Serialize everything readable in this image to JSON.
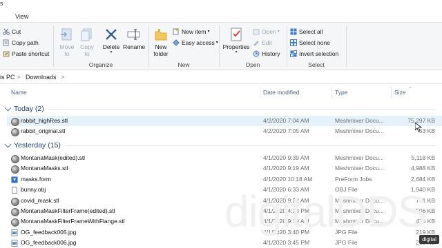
{
  "window": {
    "title_fragment": "s"
  },
  "ribbon_tabs": {
    "view": "View"
  },
  "ribbon": {
    "clipboard": {
      "cut": "Cut",
      "copy_path": "Copy path",
      "paste_shortcut": "Paste shortcut"
    },
    "organize": {
      "label": "Organize",
      "move_to": "Move\nto",
      "copy_to": "Copy\nto",
      "delete": "Delete",
      "rename": "Rename"
    },
    "new": {
      "label": "New",
      "new_folder": "New\nfolder",
      "new_item": "New item",
      "easy_access": "Easy access"
    },
    "open": {
      "label": "Open",
      "properties": "Properties",
      "open": "Open",
      "edit": "Edit",
      "history": "History"
    },
    "select": {
      "label": "Select",
      "select_all": "Select all",
      "select_none": "Select none",
      "invert": "Invert selection"
    }
  },
  "address": {
    "this_pc": "is PC",
    "sep1": ">",
    "downloads": "Downloads",
    "sep2": ">"
  },
  "columns": {
    "name": "Name",
    "date": "Date modified",
    "type": "Type",
    "size": "Size"
  },
  "groups": [
    {
      "label": "Today (2)"
    },
    {
      "label": "Yesterday (15)"
    }
  ],
  "today_rows": [
    {
      "name": "rabbit_highRes.stl",
      "date": "4/2/2020 7:04 AM",
      "type": "Meshmixer Docu...",
      "size": "75,297 KB",
      "icon": "mesh-icon",
      "selected": true
    },
    {
      "name": "rabbit_original.stl",
      "date": "4/2/2020 7:05 AM",
      "type": "Meshmixer Docu...",
      "size": "53 KB",
      "icon": "mesh-icon",
      "selected": false
    }
  ],
  "yesterday_rows": [
    {
      "name": "MontanaMask(edited).stl",
      "date": "4/1/2020 9:39 AM",
      "type": "Meshmixer Docu...",
      "size": "5,118 KB",
      "icon": "mesh-icon"
    },
    {
      "name": "MontanaMasks.stl",
      "date": "4/1/2020 9:19 AM",
      "type": "Meshmixer Docu...",
      "size": "4,988 KB",
      "icon": "mesh-icon"
    },
    {
      "name": "masks.form",
      "date": "4/1/2020 10:18 AM",
      "type": "PreForm Jobs",
      "size": "2,684 KB",
      "icon": "form-icon"
    },
    {
      "name": "bunny.obj",
      "date": "4/1/2020 6:33 AM",
      "type": "OBJ File",
      "size": "1,940 KB",
      "icon": "file-icon"
    },
    {
      "name": "covid_mask.stl",
      "date": "4/1/2020 9:22 AM",
      "type": "Meshmixer Docu...",
      "size": "741 KB",
      "icon": "mesh-icon"
    },
    {
      "name": "MontanaMaskFilterFrame(edited).stl",
      "date": "4/1/2020 4:28 PM",
      "type": "Meshmixer Docu...",
      "size": "506 KB",
      "icon": "mesh-icon"
    },
    {
      "name": "MontanaMaskFilterFrameWithFlange.stl",
      "date": "4/1/2020 9:19 AM",
      "type": "Meshmixer Docu...",
      "size": "476 KB",
      "icon": "mesh-icon"
    },
    {
      "name": "OG_feedback005.jpg",
      "date": "4/1/2020 3:40 PM",
      "type": "JPG File",
      "size": "219 KB",
      "icon": "image-icon"
    },
    {
      "name": "OG_feedback006.jpg",
      "date": "4/1/2020 3:45 PM",
      "type": "JPG File",
      "size": "213 KB",
      "icon": "image-icon"
    }
  ],
  "watermark": "digitalDDS",
  "badge": "digital"
}
